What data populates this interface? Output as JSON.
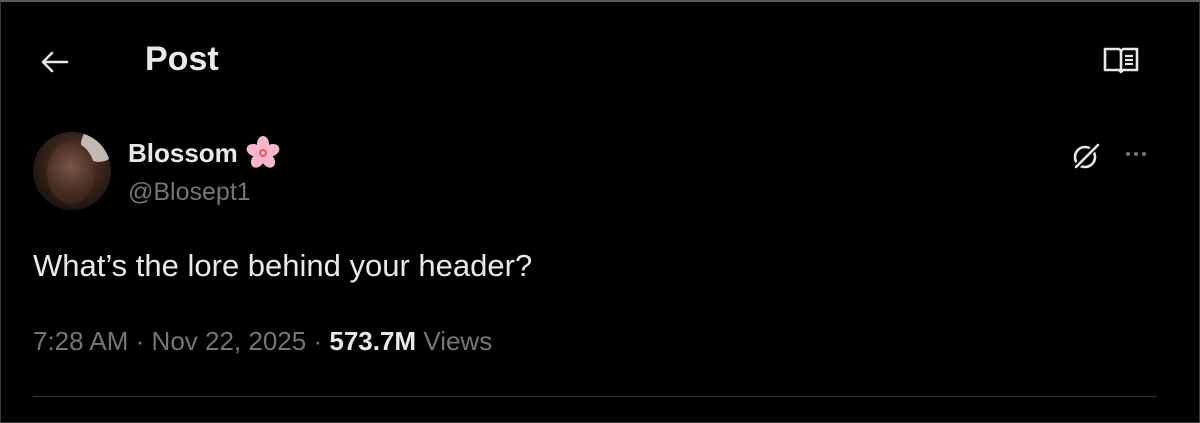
{
  "header": {
    "title": "Post"
  },
  "icons": {
    "back": "arrow-left-icon",
    "reader": "reader-mode-icon",
    "grok": "grok-icon",
    "more": "more-options-icon",
    "flower": "cherry-blossom-emoji"
  },
  "post": {
    "author_name": "Blossom",
    "author_emoji": "🌸",
    "author_handle": "@Blosept1",
    "text": "What’s the lore behind your header?",
    "time": "7:28 AM",
    "date": "Nov 22, 2025",
    "separator": "·",
    "views_count": "573.7M",
    "views_label": "Views"
  },
  "colors": {
    "background": "#000000",
    "primary_text": "#e7e9ea",
    "secondary_text": "#71767b"
  }
}
